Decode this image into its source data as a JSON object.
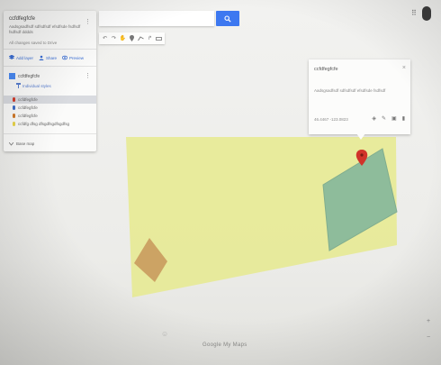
{
  "panel": {
    "map_title": "ccfdfegfcfe",
    "map_description": "Aadsgsadfsdf sdfsdfsdf efsdfsde fsdfsdf fsdfsdf dddds",
    "saved_text": "All changes saved to Drive",
    "actions": {
      "add_layer": "Add layer",
      "share": "Share",
      "preview": "Preview"
    },
    "layer": {
      "title": "ccfdfegfcfe",
      "style_label": "Individual styles",
      "items": [
        {
          "label": "ccfdfegfcfe",
          "color": "#d23b2a",
          "selected": true
        },
        {
          "label": "ccfdfegfcfe",
          "color": "#3f6ec7",
          "selected": false
        },
        {
          "label": "ccfdfegfcfe",
          "color": "#d07a2a",
          "selected": false
        },
        {
          "label": "ccfdfg dfsg dfsgdfsgdfsgdfsg",
          "color": "#e8d44a",
          "selected": false
        }
      ]
    },
    "base_map": "Base map"
  },
  "search": {
    "placeholder": ""
  },
  "popup": {
    "title": "ccfdfegfcfe",
    "description": "Aadsgsadfsdf sdfsdfsdf efsdfsde fsdfsdf",
    "link": "46.4467 -123.0823"
  },
  "map": {
    "google_text": "Google My Maps"
  },
  "colors": {
    "yellow_area": "#e6ea8e",
    "green_area": "#7fb49b",
    "brown_area": "#c99b5e",
    "search_button": "#3d78f0",
    "marker": "#d1332a"
  }
}
